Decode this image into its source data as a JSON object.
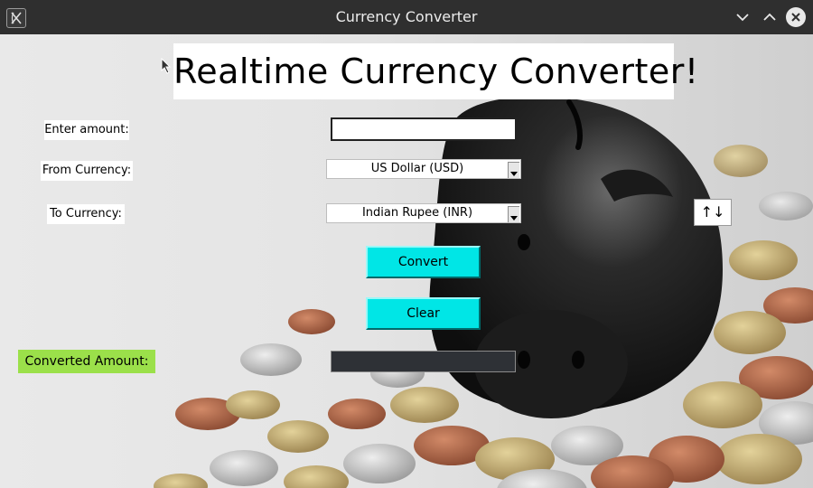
{
  "window": {
    "title": "Currency Converter",
    "app_icon": "app-icon",
    "controls": [
      "minimize-icon",
      "maximize-icon",
      "close-icon"
    ]
  },
  "main": {
    "heading": "Realtime Currency Converter!",
    "amount": {
      "label": "Enter amount:",
      "value": "",
      "placeholder": ""
    },
    "from_currency": {
      "label": "From Currency:",
      "selected": "US Dollar (USD)"
    },
    "to_currency": {
      "label": "To Currency:",
      "selected": "Indian Rupee (INR)"
    },
    "swap_button": "↑↓",
    "convert_button": "Convert",
    "clear_button": "Clear",
    "result": {
      "label": "Converted Amount:",
      "value": ""
    }
  },
  "colors": {
    "title_bar": "#2f2f2f",
    "button_fill": "#00e6e6",
    "result_label_fill": "#9be04a",
    "result_field_fill": "#2e3136"
  }
}
